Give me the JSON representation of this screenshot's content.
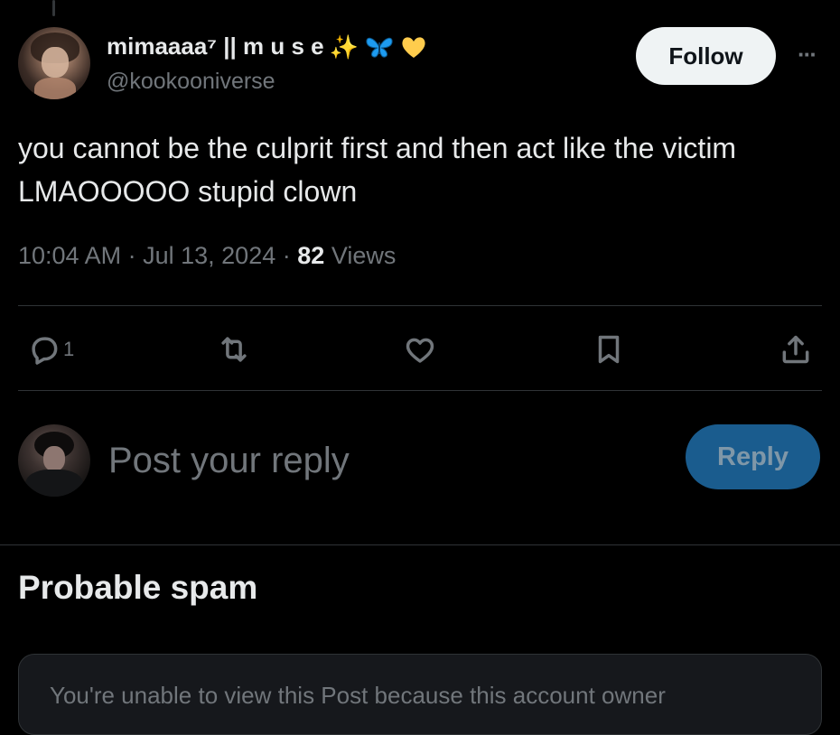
{
  "post": {
    "author": {
      "display_name": "mimaaaa⁷ || m u s e",
      "emoji_sparkles": "✨",
      "emoji_butterfly": "butterfly-emoji",
      "emoji_heart": "yellow-heart-emoji",
      "handle": "@kookooniverse"
    },
    "follow_label": "Follow",
    "more_label": "···",
    "text_line1": "you cannot be the culprit first and then act like the victim",
    "text_line2": "LMAOOOOO stupid clown",
    "time": "10:04 AM",
    "separator": "·",
    "date": "Jul 13, 2024",
    "views_count": "82",
    "views_label": "Views"
  },
  "actions": {
    "reply_count": "1",
    "icons": [
      "reply-icon",
      "repost-icon",
      "like-icon",
      "bookmark-icon",
      "share-icon"
    ]
  },
  "composer": {
    "placeholder": "Post your reply",
    "value": "",
    "reply_label": "Reply"
  },
  "spam": {
    "heading": "Probable spam",
    "notice": "You're unable to view this Post because this account owner"
  },
  "colors": {
    "background": "#000000",
    "text_primary": "#e7e9ea",
    "text_secondary": "#71767b",
    "divider": "#2f3336",
    "follow_bg": "#eff3f4",
    "reply_button_bg": "#1a5c8e",
    "sparkle": "#f5c518",
    "butterfly": "#1d9bf0",
    "heart": "#ffcc4d"
  }
}
